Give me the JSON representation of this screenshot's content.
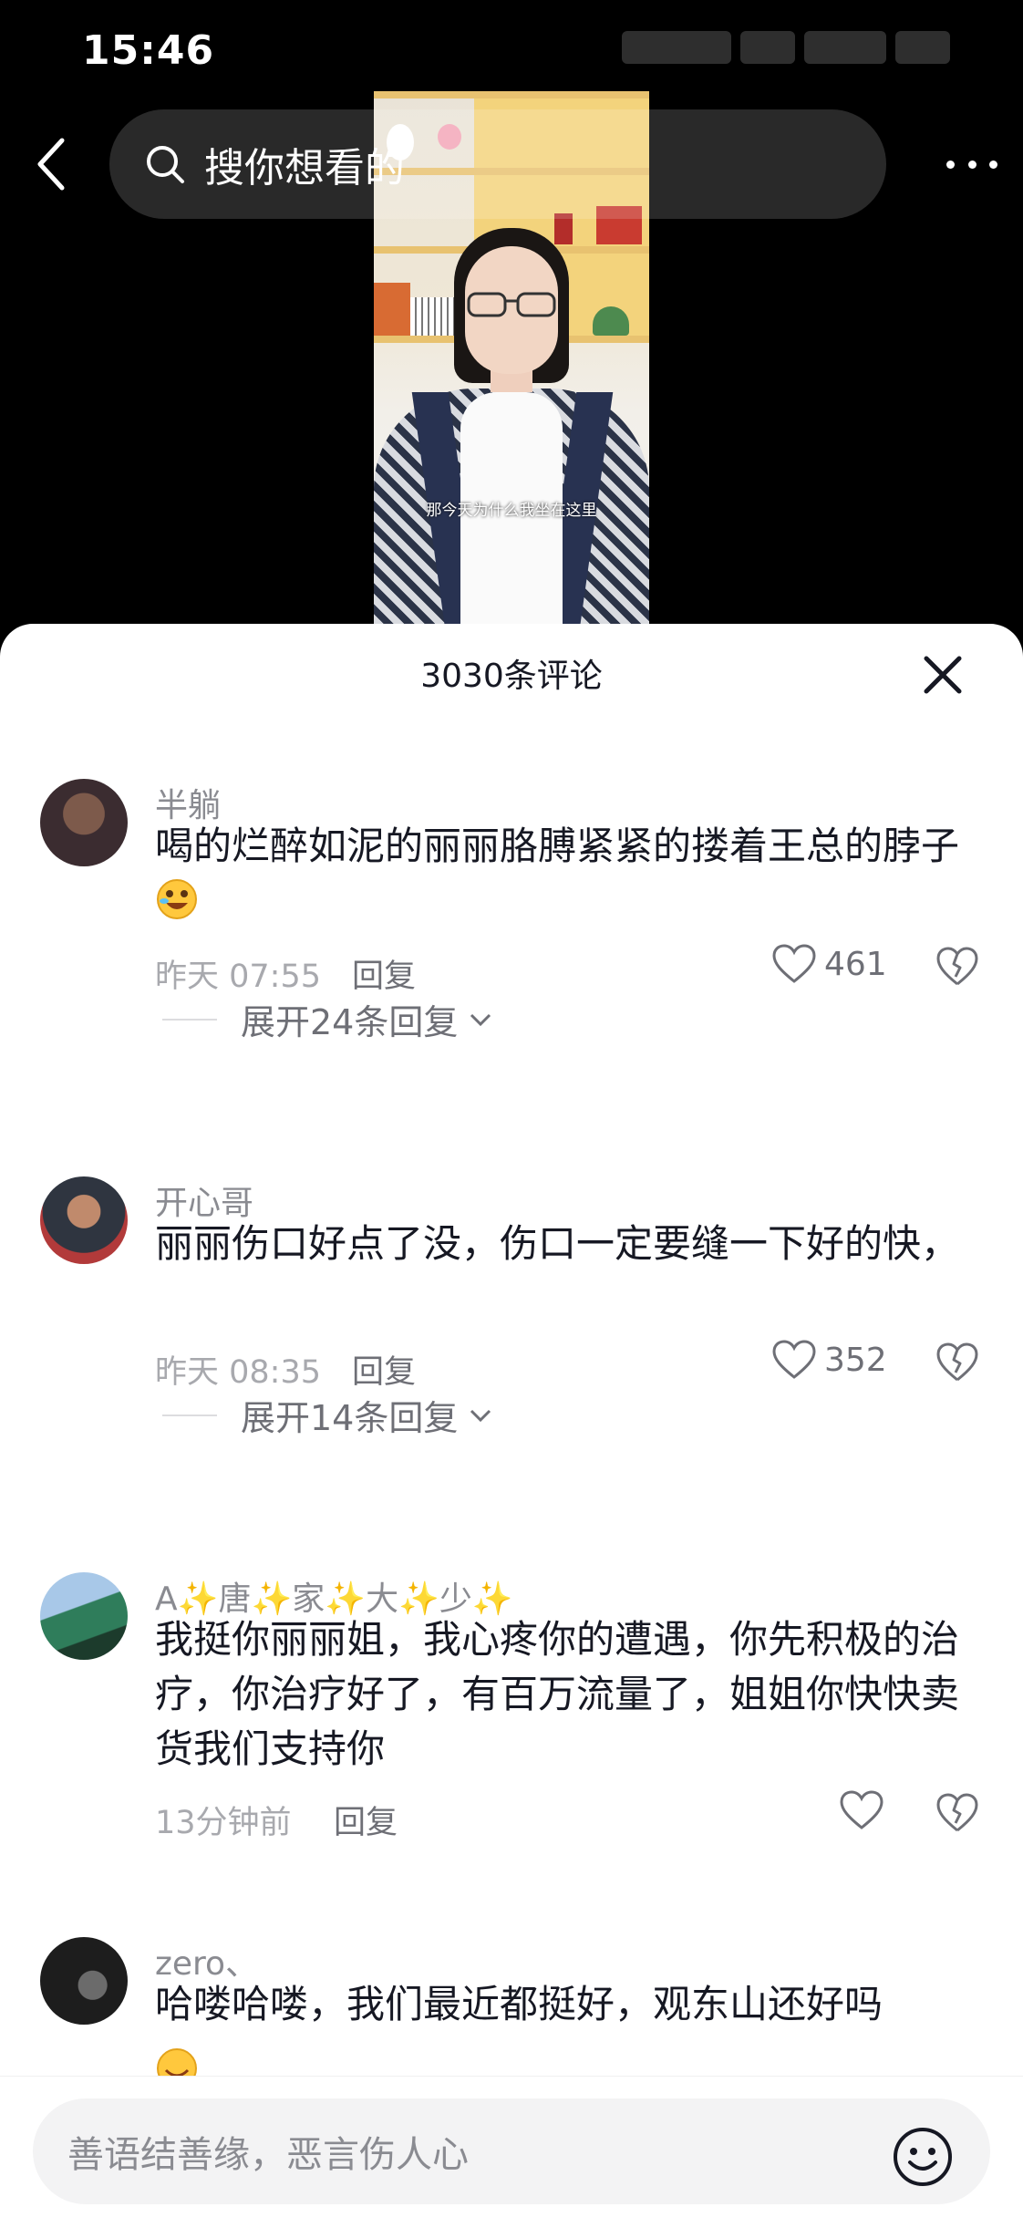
{
  "status_bar": {
    "time": "15:46"
  },
  "search": {
    "placeholder": "搜你想看的"
  },
  "video": {
    "subtitle": "那今天为什么我坐在这里"
  },
  "sheet": {
    "title": "3030条评论"
  },
  "comments": [
    {
      "name": "半躺",
      "text": "喝的烂醉如泥的丽丽胳膊紧紧的搂着王总的脖子",
      "emoji": "rofl",
      "time": "昨天 07:55",
      "reply": "回复",
      "likes": "461",
      "expand": "展开24条回复"
    },
    {
      "name": "开心哥",
      "text": "丽丽伤口好点了没，伤口一定要缝一下好的快，",
      "time": "昨天 08:35",
      "reply": "回复",
      "likes": "352",
      "expand": "展开14条回复"
    },
    {
      "name": "A✨唐✨家✨大✨少✨",
      "text": "我挺你丽丽姐，我心疼你的遭遇，你先积极的治疗，你治疗好了，有百万流量了，姐姐你快快卖货我们支持你",
      "time": "13分钟前",
      "reply": "回复",
      "likes": ""
    },
    {
      "name": "zero、",
      "text": "哈喽哈喽，我们最近都挺好，观东山还好吗"
    }
  ],
  "input": {
    "placeholder": "善语结善缘，恶言伤人心"
  },
  "icons": {
    "back": "back-arrow-icon",
    "search": "search-icon",
    "more": "more-icon",
    "close": "close-icon",
    "like": "heart-icon",
    "dislike": "broken-heart-icon",
    "expand": "chevron-down-icon",
    "emoji": "emoji-icon"
  }
}
